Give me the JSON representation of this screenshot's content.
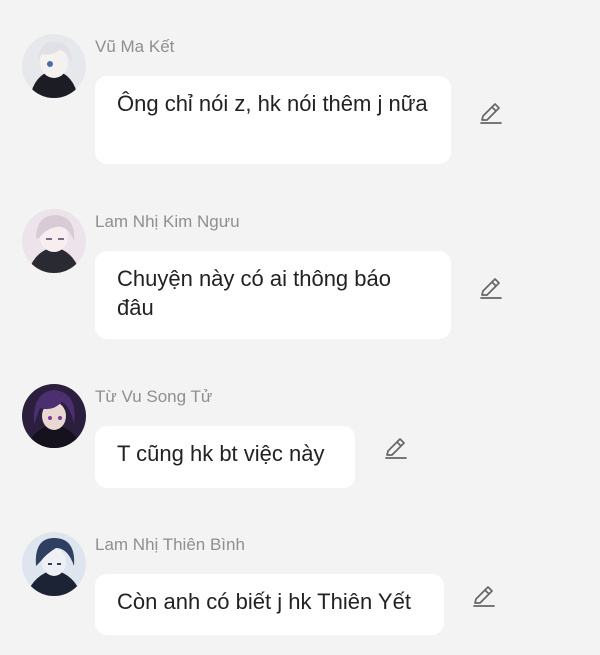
{
  "messages": [
    {
      "sender": "Vũ Ma Kết",
      "text": "Ông chỉ nói z, hk nói thêm j nữa",
      "edit_icon": "pencil-icon",
      "avatar_tone": "#c9ccd3"
    },
    {
      "sender": "Lam Nhị Kim Ngưu",
      "text": "Chuyện này có ai thông báo đâu",
      "edit_icon": "pencil-icon",
      "avatar_tone": "#d9cdd6"
    },
    {
      "sender": "Từ Vu Song Tử",
      "text": "T cũng hk bt việc này",
      "edit_icon": "pencil-icon",
      "avatar_tone": "#3b2a55"
    },
    {
      "sender": "Lam Nhị Thiên Bình",
      "text": "Còn anh có biết j hk Thiên Yết",
      "edit_icon": "pencil-icon",
      "avatar_tone": "#2d3b5c"
    }
  ]
}
